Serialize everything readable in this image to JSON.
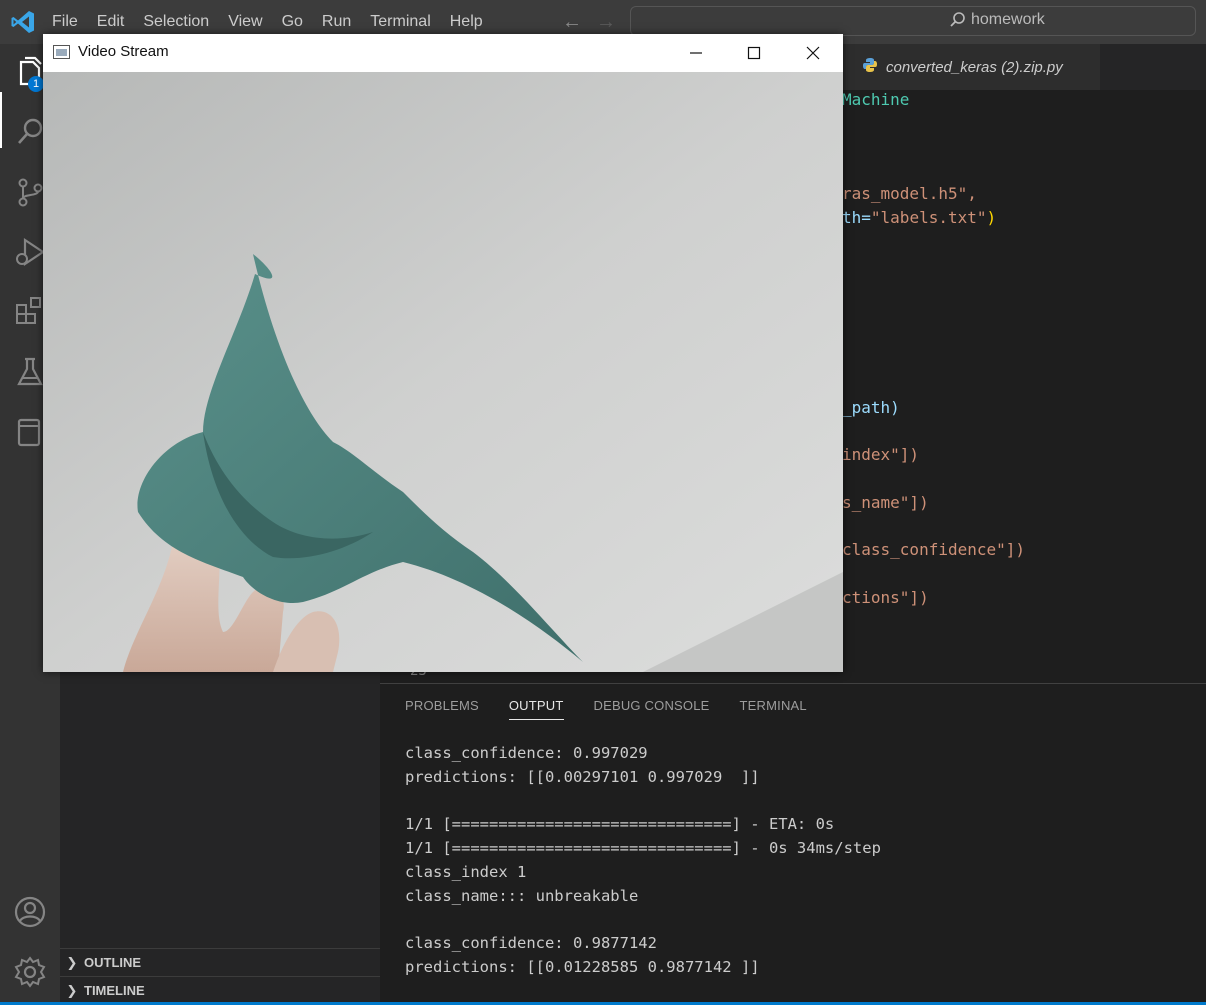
{
  "menu": [
    "File",
    "Edit",
    "Selection",
    "View",
    "Go",
    "Run",
    "Terminal",
    "Help"
  ],
  "search": {
    "text": "homework"
  },
  "activity": {
    "explorer_badge": "1"
  },
  "editor": {
    "tab_label": "converted_keras (2).zip.py",
    "code_fragments": [
      "Machine",
      "ras_model.h5\",",
      "th=\"labels.txt\")",
      "_path)",
      "index\"])",
      "s_name\"])",
      "class_confidence\"])",
      "ctions\"])"
    ],
    "last_line_number": "23"
  },
  "sidebar": {
    "outline": "OUTLINE",
    "timeline": "TIMELINE"
  },
  "panel": {
    "tabs": [
      "PROBLEMS",
      "OUTPUT",
      "DEBUG CONSOLE",
      "TERMINAL"
    ],
    "active_tab": "OUTPUT",
    "output_lines": [
      "class_confidence: 0.997029",
      "predictions: [[0.00297101 0.997029  ]]",
      "",
      "1/1 [==============================] - ETA: 0s",
      "1/1 [==============================] - 0s 34ms/step",
      "class_index 1",
      "class_name::: unbreakable",
      "",
      "class_confidence: 0.9877142",
      "predictions: [[0.01228585 0.9877142 ]]"
    ]
  },
  "window": {
    "title": "Video Stream"
  },
  "colors": {
    "accent": "#007acc",
    "titlebar": "#3c3c3c",
    "activitybar": "#333333",
    "sidebar": "#252526",
    "editor": "#1e1e1e",
    "cloth": "#4f8580"
  },
  "icons": [
    "vscode-logo-icon",
    "files-icon",
    "search-icon",
    "source-control-icon",
    "run-debug-icon",
    "extensions-icon",
    "testing-icon",
    "remote-explorer-icon",
    "account-icon",
    "settings-gear-icon",
    "python-icon"
  ]
}
